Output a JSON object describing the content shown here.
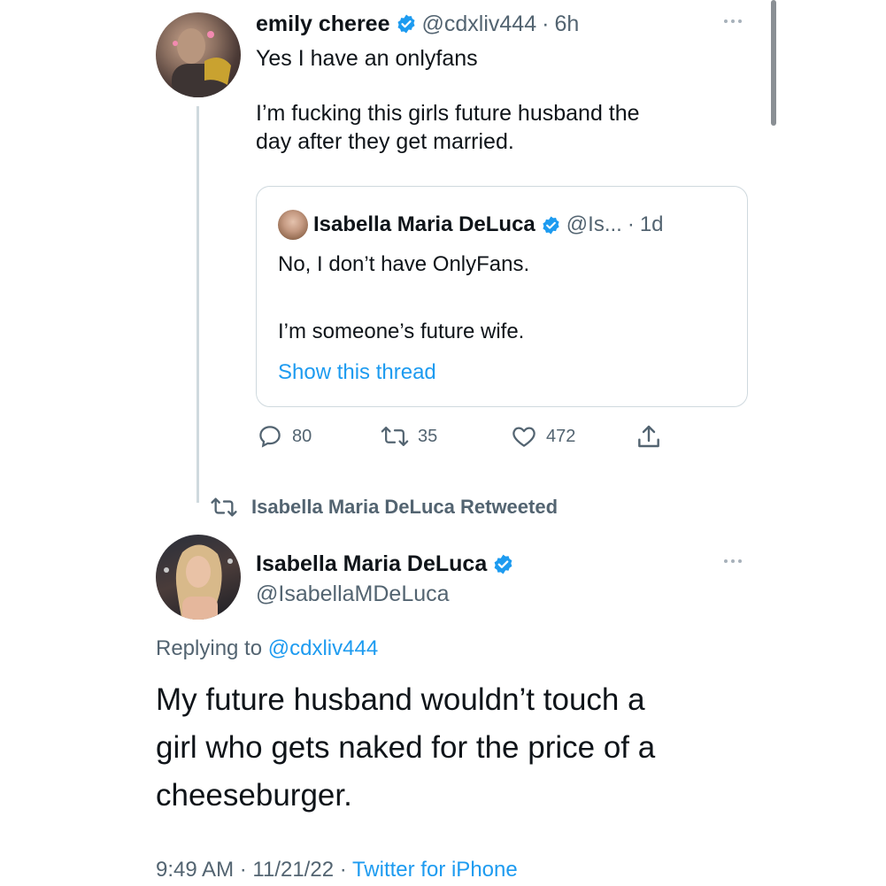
{
  "tweet1": {
    "display_name": "emily cheree",
    "handle": "@cdxliv444",
    "sep": "·",
    "time": "6h",
    "line1": "Yes I have an onlyfans",
    "line2": "I’m fucking this girls future husband the",
    "line3": "day after they get married.",
    "quote": {
      "display_name": "Isabella Maria DeLuca",
      "handle": "@Is...",
      "sep": "·",
      "time": "1d",
      "line1": "No, I don’t have OnlyFans.",
      "line2": "I’m someone’s future wife.",
      "show_thread": "Show this thread"
    },
    "actions": {
      "replies": "80",
      "retweets": "35",
      "likes": "472"
    }
  },
  "retweet_banner": "Isabella Maria DeLuca Retweeted",
  "tweet2": {
    "display_name": "Isabella Maria DeLuca",
    "handle": "@IsabellaMDeLuca",
    "replying_prefix": "Replying to",
    "replying_handle": "@cdxliv444",
    "line1": "My future husband wouldn’t touch a",
    "line2": "girl who gets naked for the price of a",
    "line3": "cheeseburger.",
    "time": "9:49 AM",
    "sep1": "·",
    "date": "11/21/22",
    "sep2": "·",
    "source": "Twitter for iPhone"
  },
  "colors": {
    "accent": "#1d9bf0",
    "muted": "#536471",
    "border": "#cfd9de",
    "thread_line": "#cfd9de"
  }
}
